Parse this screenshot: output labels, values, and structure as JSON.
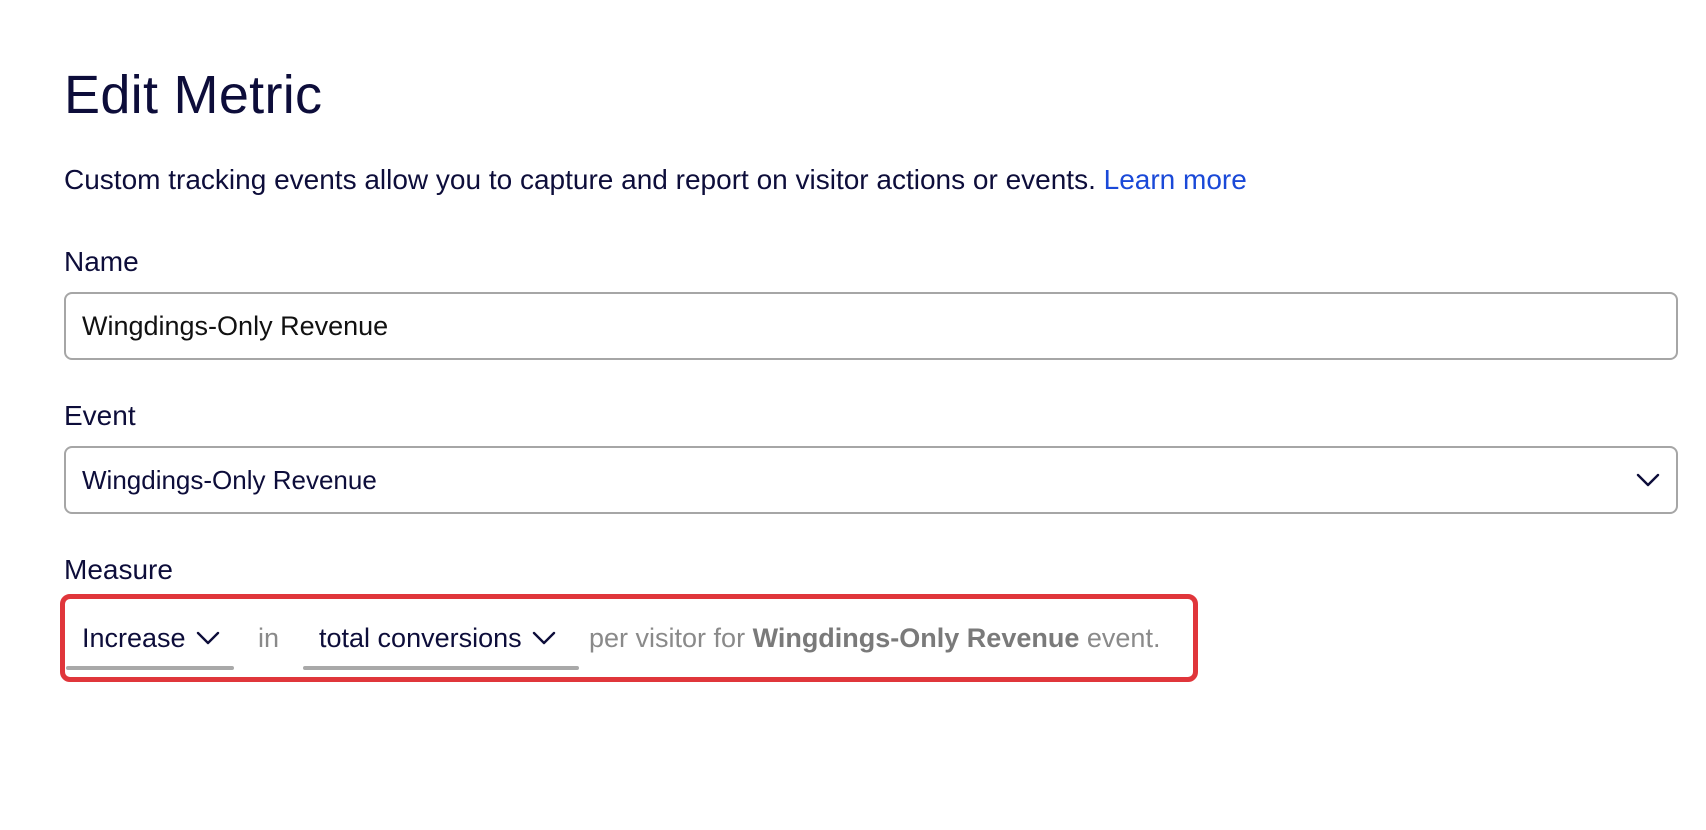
{
  "page": {
    "title": "Edit Metric",
    "description": "Custom tracking events allow you to capture and report on visitor actions or events.",
    "learn_more": "Learn more"
  },
  "name_field": {
    "label": "Name",
    "value": "Wingdings-Only Revenue"
  },
  "event_field": {
    "label": "Event",
    "selected": "Wingdings-Only Revenue",
    "icon": "chevron-down-icon"
  },
  "measure": {
    "label": "Measure",
    "direction": "Increase",
    "connector": "in",
    "aggregation": "total conversions",
    "suffix_before": "per visitor for",
    "event_name": "Wingdings-Only Revenue",
    "suffix_after": "event.",
    "highlight_color": "#e0363b"
  },
  "colors": {
    "heading": "#0d0d3a",
    "link": "#1a49d8",
    "border": "#a6a6a6",
    "muted": "#8a8a8a"
  }
}
